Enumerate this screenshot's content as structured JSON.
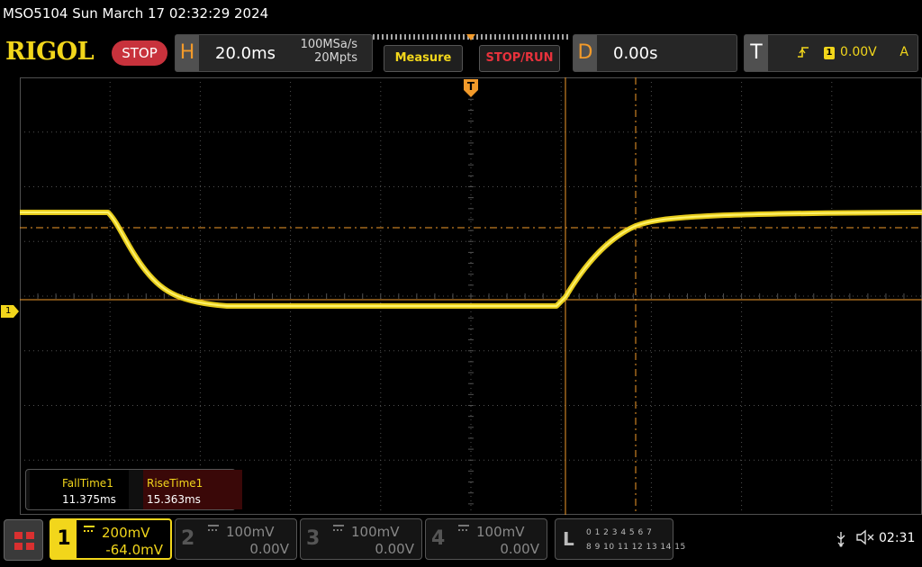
{
  "title": "MSO5104  Sun March 17 02:32:29 2024",
  "brand": {
    "logo": "RIGOL",
    "run_state": "STOP"
  },
  "horizontal": {
    "letter": "H",
    "timebase": "20.0ms",
    "sample_rate": "100MSa/s",
    "memory_depth": "20Mpts"
  },
  "buttons": {
    "measure": "Measure",
    "stop_run": "STOP/RUN"
  },
  "delay": {
    "letter": "D",
    "value": "0.00s"
  },
  "trigger": {
    "letter": "T",
    "edge_icon": "rising-edge-icon",
    "channel": "1",
    "level": "0.00V",
    "mode": "A"
  },
  "screen": {
    "ch1_marker": "1",
    "trigger_marker": "T"
  },
  "measurements": [
    {
      "label": "FallTime1",
      "value": "11.375ms"
    },
    {
      "label": "RiseTime1",
      "value": "15.363ms"
    }
  ],
  "channels": [
    {
      "num": "1",
      "scale": "200mV",
      "offset": "-64.0mV",
      "active": true
    },
    {
      "num": "2",
      "scale": "100mV",
      "offset": "0.00V",
      "active": false
    },
    {
      "num": "3",
      "scale": "100mV",
      "offset": "0.00V",
      "active": false
    },
    {
      "num": "4",
      "scale": "100mV",
      "offset": "0.00V",
      "active": false
    }
  ],
  "logic": {
    "letter": "L",
    "row1": "0 1 2 3   4 5 6 7",
    "row2": "8 9 10 11 12 13 14 15"
  },
  "status": {
    "usb_icon": "usb-icon",
    "sound_icon": "speaker-muted-icon",
    "time": "02:31"
  },
  "colors": {
    "ch1": "#f2d61b",
    "trigger": "#f29a2a",
    "stop": "#c8323c",
    "grid": "#505050"
  }
}
